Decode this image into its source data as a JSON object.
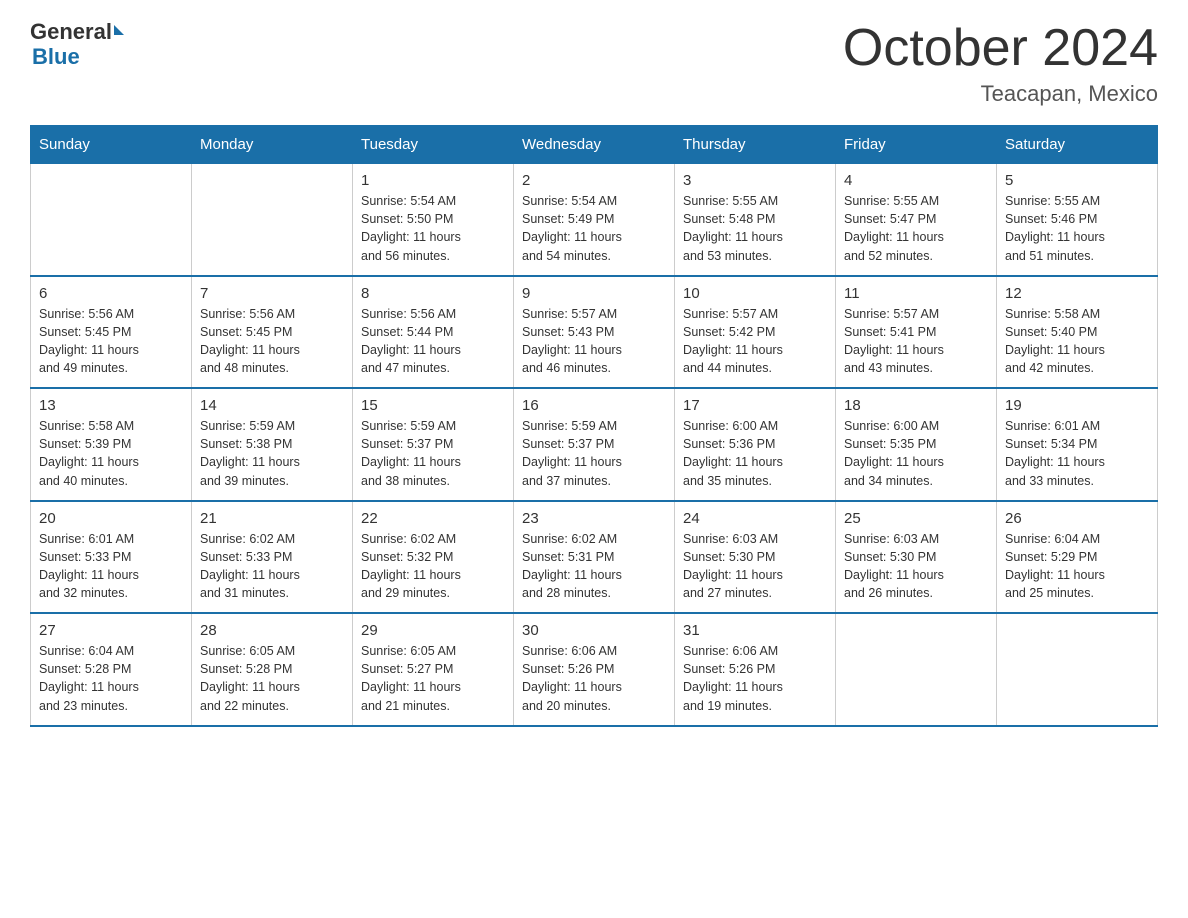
{
  "header": {
    "logo_general": "General",
    "logo_blue": "Blue",
    "main_title": "October 2024",
    "subtitle": "Teacapan, Mexico"
  },
  "weekdays": [
    "Sunday",
    "Monday",
    "Tuesday",
    "Wednesday",
    "Thursday",
    "Friday",
    "Saturday"
  ],
  "weeks": [
    [
      {
        "day": "",
        "info": ""
      },
      {
        "day": "",
        "info": ""
      },
      {
        "day": "1",
        "info": "Sunrise: 5:54 AM\nSunset: 5:50 PM\nDaylight: 11 hours\nand 56 minutes."
      },
      {
        "day": "2",
        "info": "Sunrise: 5:54 AM\nSunset: 5:49 PM\nDaylight: 11 hours\nand 54 minutes."
      },
      {
        "day": "3",
        "info": "Sunrise: 5:55 AM\nSunset: 5:48 PM\nDaylight: 11 hours\nand 53 minutes."
      },
      {
        "day": "4",
        "info": "Sunrise: 5:55 AM\nSunset: 5:47 PM\nDaylight: 11 hours\nand 52 minutes."
      },
      {
        "day": "5",
        "info": "Sunrise: 5:55 AM\nSunset: 5:46 PM\nDaylight: 11 hours\nand 51 minutes."
      }
    ],
    [
      {
        "day": "6",
        "info": "Sunrise: 5:56 AM\nSunset: 5:45 PM\nDaylight: 11 hours\nand 49 minutes."
      },
      {
        "day": "7",
        "info": "Sunrise: 5:56 AM\nSunset: 5:45 PM\nDaylight: 11 hours\nand 48 minutes."
      },
      {
        "day": "8",
        "info": "Sunrise: 5:56 AM\nSunset: 5:44 PM\nDaylight: 11 hours\nand 47 minutes."
      },
      {
        "day": "9",
        "info": "Sunrise: 5:57 AM\nSunset: 5:43 PM\nDaylight: 11 hours\nand 46 minutes."
      },
      {
        "day": "10",
        "info": "Sunrise: 5:57 AM\nSunset: 5:42 PM\nDaylight: 11 hours\nand 44 minutes."
      },
      {
        "day": "11",
        "info": "Sunrise: 5:57 AM\nSunset: 5:41 PM\nDaylight: 11 hours\nand 43 minutes."
      },
      {
        "day": "12",
        "info": "Sunrise: 5:58 AM\nSunset: 5:40 PM\nDaylight: 11 hours\nand 42 minutes."
      }
    ],
    [
      {
        "day": "13",
        "info": "Sunrise: 5:58 AM\nSunset: 5:39 PM\nDaylight: 11 hours\nand 40 minutes."
      },
      {
        "day": "14",
        "info": "Sunrise: 5:59 AM\nSunset: 5:38 PM\nDaylight: 11 hours\nand 39 minutes."
      },
      {
        "day": "15",
        "info": "Sunrise: 5:59 AM\nSunset: 5:37 PM\nDaylight: 11 hours\nand 38 minutes."
      },
      {
        "day": "16",
        "info": "Sunrise: 5:59 AM\nSunset: 5:37 PM\nDaylight: 11 hours\nand 37 minutes."
      },
      {
        "day": "17",
        "info": "Sunrise: 6:00 AM\nSunset: 5:36 PM\nDaylight: 11 hours\nand 35 minutes."
      },
      {
        "day": "18",
        "info": "Sunrise: 6:00 AM\nSunset: 5:35 PM\nDaylight: 11 hours\nand 34 minutes."
      },
      {
        "day": "19",
        "info": "Sunrise: 6:01 AM\nSunset: 5:34 PM\nDaylight: 11 hours\nand 33 minutes."
      }
    ],
    [
      {
        "day": "20",
        "info": "Sunrise: 6:01 AM\nSunset: 5:33 PM\nDaylight: 11 hours\nand 32 minutes."
      },
      {
        "day": "21",
        "info": "Sunrise: 6:02 AM\nSunset: 5:33 PM\nDaylight: 11 hours\nand 31 minutes."
      },
      {
        "day": "22",
        "info": "Sunrise: 6:02 AM\nSunset: 5:32 PM\nDaylight: 11 hours\nand 29 minutes."
      },
      {
        "day": "23",
        "info": "Sunrise: 6:02 AM\nSunset: 5:31 PM\nDaylight: 11 hours\nand 28 minutes."
      },
      {
        "day": "24",
        "info": "Sunrise: 6:03 AM\nSunset: 5:30 PM\nDaylight: 11 hours\nand 27 minutes."
      },
      {
        "day": "25",
        "info": "Sunrise: 6:03 AM\nSunset: 5:30 PM\nDaylight: 11 hours\nand 26 minutes."
      },
      {
        "day": "26",
        "info": "Sunrise: 6:04 AM\nSunset: 5:29 PM\nDaylight: 11 hours\nand 25 minutes."
      }
    ],
    [
      {
        "day": "27",
        "info": "Sunrise: 6:04 AM\nSunset: 5:28 PM\nDaylight: 11 hours\nand 23 minutes."
      },
      {
        "day": "28",
        "info": "Sunrise: 6:05 AM\nSunset: 5:28 PM\nDaylight: 11 hours\nand 22 minutes."
      },
      {
        "day": "29",
        "info": "Sunrise: 6:05 AM\nSunset: 5:27 PM\nDaylight: 11 hours\nand 21 minutes."
      },
      {
        "day": "30",
        "info": "Sunrise: 6:06 AM\nSunset: 5:26 PM\nDaylight: 11 hours\nand 20 minutes."
      },
      {
        "day": "31",
        "info": "Sunrise: 6:06 AM\nSunset: 5:26 PM\nDaylight: 11 hours\nand 19 minutes."
      },
      {
        "day": "",
        "info": ""
      },
      {
        "day": "",
        "info": ""
      }
    ]
  ]
}
